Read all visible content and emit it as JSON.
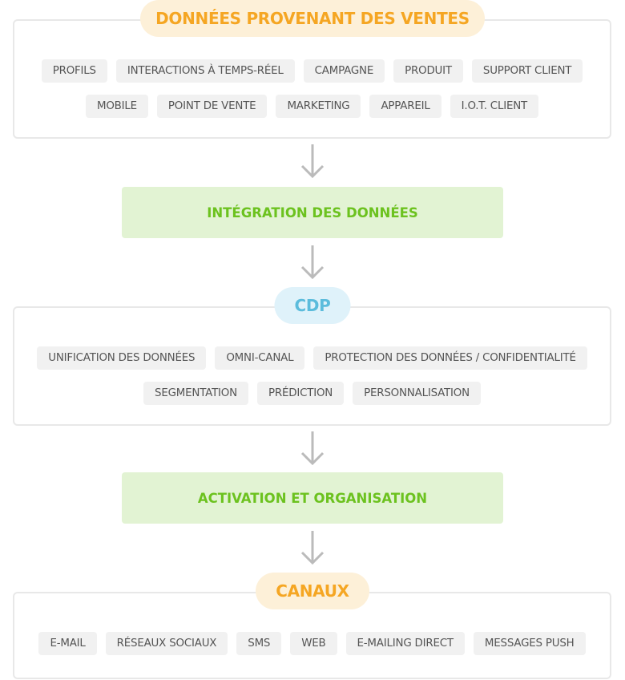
{
  "sources": {
    "title": "DONNÉES PROVENANT DES VENTES",
    "row1": [
      "PROFILS",
      "INTERACTIONS À TEMPS-RÉEL",
      "CAMPAGNE",
      "PRODUIT",
      "SUPPORT CLIENT"
    ],
    "row2": [
      "MOBILE",
      "POINT DE VENTE",
      "MARKETING",
      "APPAREIL",
      "I.O.T. CLIENT"
    ]
  },
  "integration": {
    "label": "INTÉGRATION DES DONNÉES"
  },
  "cdp": {
    "title": "CDP",
    "row1": [
      "UNIFICATION DES DONNÉES",
      "OMNI-CANAL",
      "PROTECTION DES DONNÉES / CONFIDENTIALITÉ"
    ],
    "row2": [
      "SEGMENTATION",
      "PRÉDICTION",
      "PERSONNALISATION"
    ]
  },
  "activation": {
    "label": "ACTIVATION ET ORGANISATION"
  },
  "canaux": {
    "title": "CANAUX",
    "row1": [
      "E-MAIL",
      "RÉSEAUX SOCIAUX",
      "SMS",
      "WEB",
      "E-MAILING DIRECT",
      "MESSAGES PUSH"
    ]
  },
  "icons": {
    "flow_arrow": "arrow-down-icon"
  },
  "colors": {
    "orange_accent": "#f5a623",
    "orange_bg": "#fdf0d8",
    "blue_accent": "#5bbcdc",
    "blue_bg": "#dff2fa",
    "green_accent": "#6cc21f",
    "green_bg": "#e2f3d3",
    "tag_bg": "#f1f1f1",
    "tag_text": "#555555",
    "arrow": "#bbbbbb"
  }
}
